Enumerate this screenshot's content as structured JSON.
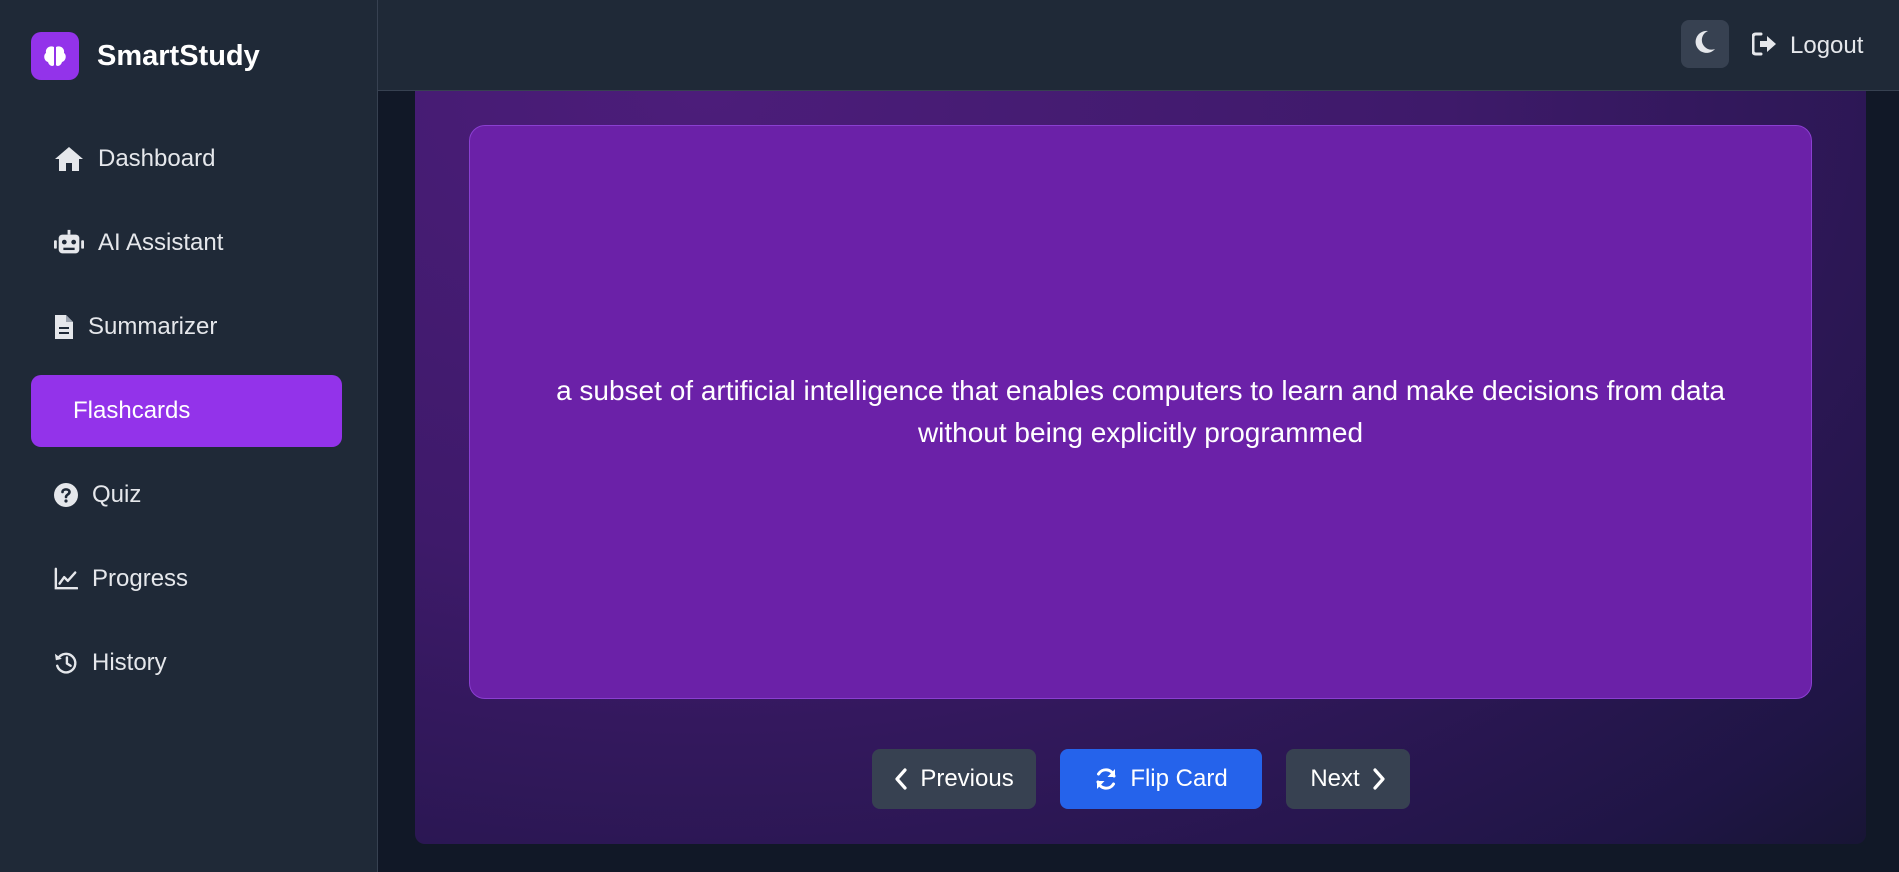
{
  "app": {
    "name": "SmartStudy"
  },
  "sidebar": {
    "items": [
      {
        "label": "Dashboard",
        "icon": "home-icon"
      },
      {
        "label": "AI Assistant",
        "icon": "robot-icon"
      },
      {
        "label": "Summarizer",
        "icon": "file-icon"
      },
      {
        "label": "Flashcards",
        "icon": "",
        "active": true
      },
      {
        "label": "Quiz",
        "icon": "question-circle-icon"
      },
      {
        "label": "Progress",
        "icon": "chart-line-icon"
      },
      {
        "label": "History",
        "icon": "history-icon"
      }
    ]
  },
  "header": {
    "theme_toggle_icon": "moon-icon",
    "logout_label": "Logout"
  },
  "flashcard": {
    "text": "a subset of artificial intelligence that enables computers to learn and make decisions from data without being explicitly programmed"
  },
  "controls": {
    "previous_label": "Previous",
    "flip_label": "Flip Card",
    "next_label": "Next"
  },
  "colors": {
    "accent": "#9333ea",
    "card": "#6b21a8",
    "primary_button": "#2563eb",
    "secondary_button": "#374151"
  }
}
